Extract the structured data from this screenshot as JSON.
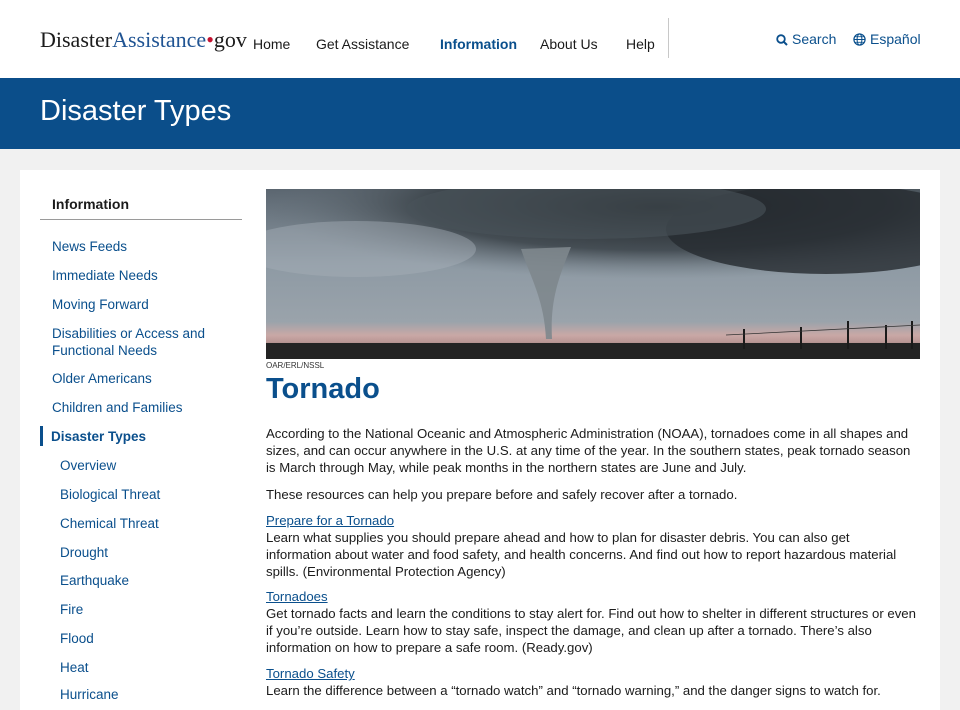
{
  "header": {
    "logo": {
      "part1": "Disaster",
      "part2": "Assistance",
      "dot": "•",
      "part3": "gov"
    },
    "nav": [
      "Home",
      "Get Assistance",
      "Information",
      "About Us",
      "Help"
    ],
    "active_nav": "Information",
    "search_label": "Search",
    "language_label": "Español"
  },
  "banner": {
    "title": "Disaster Types"
  },
  "sidebar": {
    "heading": "Information",
    "items": [
      "News Feeds",
      "Immediate Needs",
      "Moving Forward",
      "Disabilities or Access and Functional Needs",
      "Older Americans",
      "Children and Families",
      "Disaster Types"
    ],
    "subitems": [
      "Overview",
      "Biological Threat",
      "Chemical Threat",
      "Drought",
      "Earthquake",
      "Fire",
      "Flood",
      "Heat",
      "Hurricane"
    ]
  },
  "article": {
    "image_credit": "OAR/ERL/NSSL",
    "title": "Tornado",
    "intro": "According to the National Oceanic and Atmospheric Administration (NOAA), tornadoes come in all shapes and sizes, and can occur anywhere in the U.S. at any time of the year. In the southern states, peak tornado season is March through May, while peak months in the northern states are June and July.",
    "lead": "These resources can help you prepare before and safely recover after a tornado.",
    "resources": [
      {
        "link": "Prepare for a Tornado",
        "text": "Learn what supplies you should prepare ahead and how to plan for disaster debris. You can also get information about water and food safety, and health concerns. And find out how to report hazardous material spills. (Environmental Protection Agency)"
      },
      {
        "link": "Tornadoes",
        "text": "Get tornado facts and learn the conditions to stay alert for. Find out how to shelter in different structures or even if you’re outside. Learn how to stay safe, inspect the damage, and clean up after a tornado. There’s also information on how to prepare a safe room. (Ready.gov)"
      },
      {
        "link": "Tornado Safety",
        "text": "Learn the difference between a “tornado watch” and “tornado warning,” and the danger signs to watch for."
      }
    ]
  },
  "colors": {
    "brand_blue": "#0b4e8a",
    "link_blue": "#0a4f8c",
    "logo_dot_red": "#c41230"
  }
}
